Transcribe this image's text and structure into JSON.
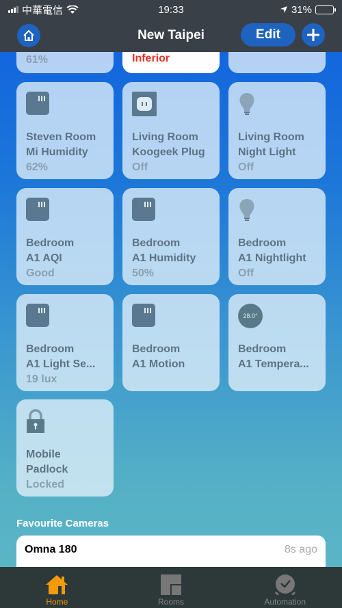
{
  "status_bar": {
    "carrier": "中華電信",
    "time": "19:33",
    "battery_percent": "31%",
    "battery_level": 0.31
  },
  "nav": {
    "title": "New Taipei",
    "edit_label": "Edit"
  },
  "top_partial_tiles": [
    {
      "status": "61%"
    },
    {
      "status": "Inferior"
    },
    {
      "status": ""
    }
  ],
  "accessories": [
    {
      "room": "Steven Room",
      "name": "Mi Humidity",
      "status": "62%",
      "icon": "sensor-icon"
    },
    {
      "room": "Living Room",
      "name": "Koogeek Plug",
      "status": "Off",
      "icon": "plug-icon"
    },
    {
      "room": "Living Room",
      "name": "Night Light",
      "status": "Off",
      "icon": "bulb-icon"
    },
    {
      "room": "Bedroom",
      "name": "A1 AQI",
      "status": "Good",
      "icon": "sensor-icon"
    },
    {
      "room": "Bedroom",
      "name": "A1 Humidity",
      "status": "50%",
      "icon": "sensor-icon"
    },
    {
      "room": "Bedroom",
      "name": "A1 Nightlight",
      "status": "Off",
      "icon": "bulb-icon"
    },
    {
      "room": "Bedroom",
      "name": "A1 Light Se...",
      "status": "19 lux",
      "icon": "sensor-icon"
    },
    {
      "room": "Bedroom",
      "name": "A1 Motion",
      "status": "",
      "icon": "sensor-icon"
    },
    {
      "room": "Bedroom",
      "name": "A1 Tempera...",
      "status": "",
      "icon": "thermometer-icon",
      "icon_text": "28.0°"
    },
    {
      "room": "Mobile",
      "name": "Padlock",
      "status": "Locked",
      "icon": "lock-icon"
    }
  ],
  "cameras": {
    "section_title": "Favourite Cameras",
    "items": [
      {
        "name": "Omna 180",
        "updated": "8s ago"
      }
    ]
  },
  "tabs": [
    {
      "label": "Home",
      "active": true
    },
    {
      "label": "Rooms",
      "active": false
    },
    {
      "label": "Automation",
      "active": false
    }
  ],
  "colors": {
    "accent": "#f39a0a",
    "alert": "#e8302a",
    "button": "#1e63c0"
  }
}
